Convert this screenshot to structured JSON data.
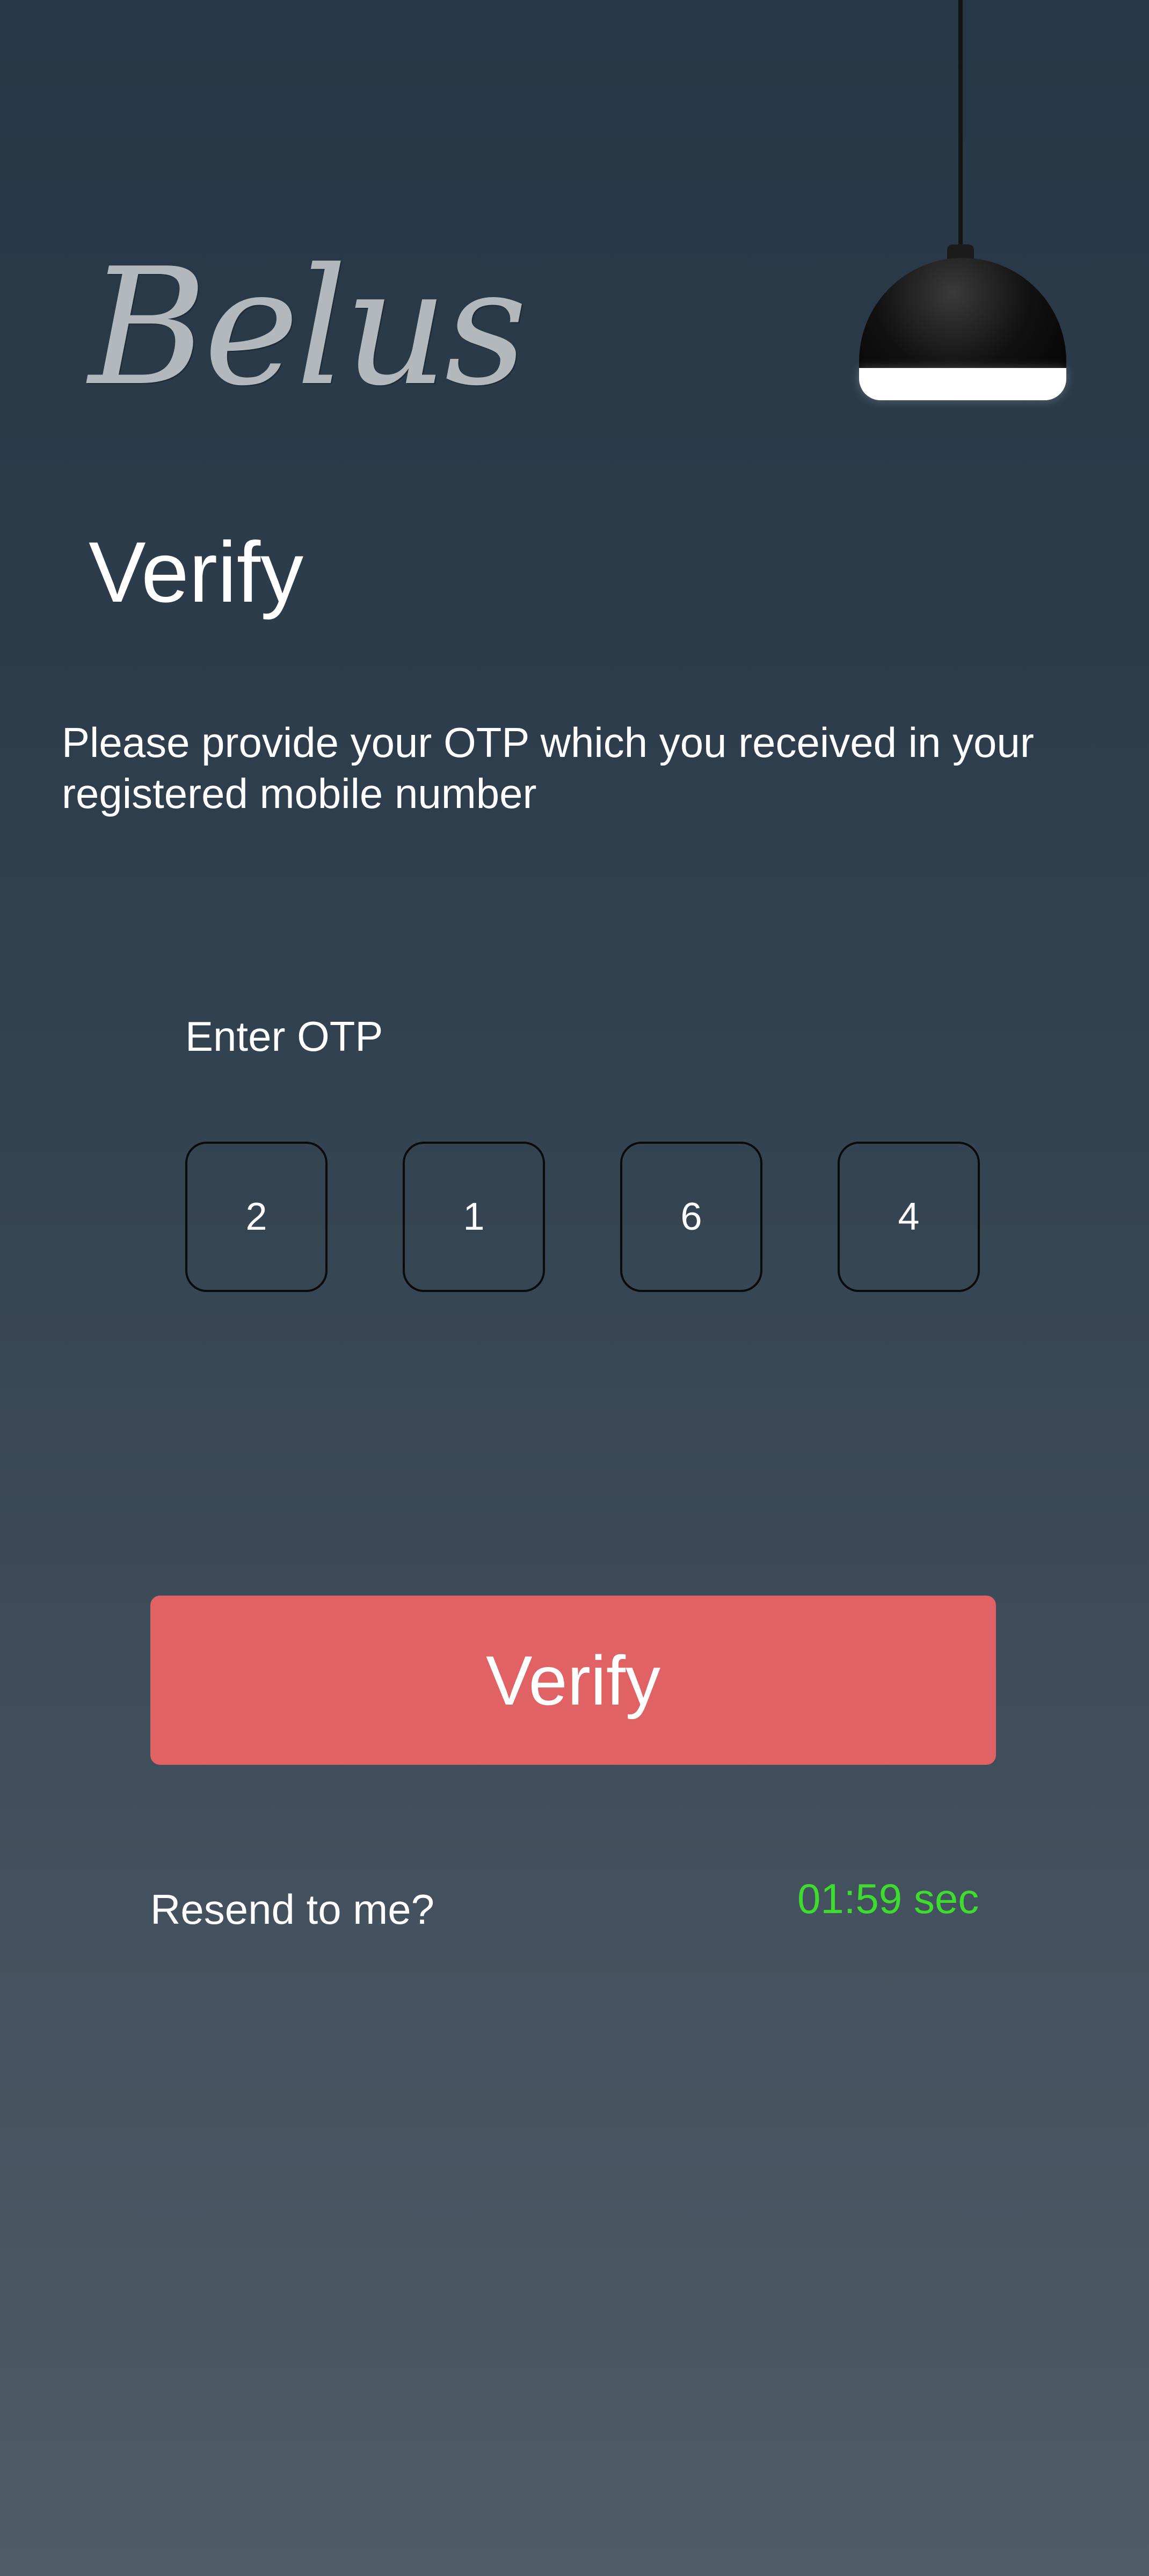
{
  "brand": {
    "name": "Belus"
  },
  "page": {
    "title": "Verify",
    "instructions": "Please provide your OTP which you received in your registered mobile number"
  },
  "otp": {
    "label": "Enter OTP",
    "digits": [
      "2",
      "1",
      "6",
      "4"
    ]
  },
  "actions": {
    "verify_label": "Verify",
    "resend_label": "Resend to me?"
  },
  "timer": {
    "text": "01:59 sec"
  },
  "colors": {
    "background_top": "#263646",
    "background_bottom": "#4f5b66",
    "button": "#e06264",
    "timer": "#3ddc2f",
    "text": "#ffffff"
  },
  "icons": {
    "lamp": "pendant-lamp-icon"
  }
}
